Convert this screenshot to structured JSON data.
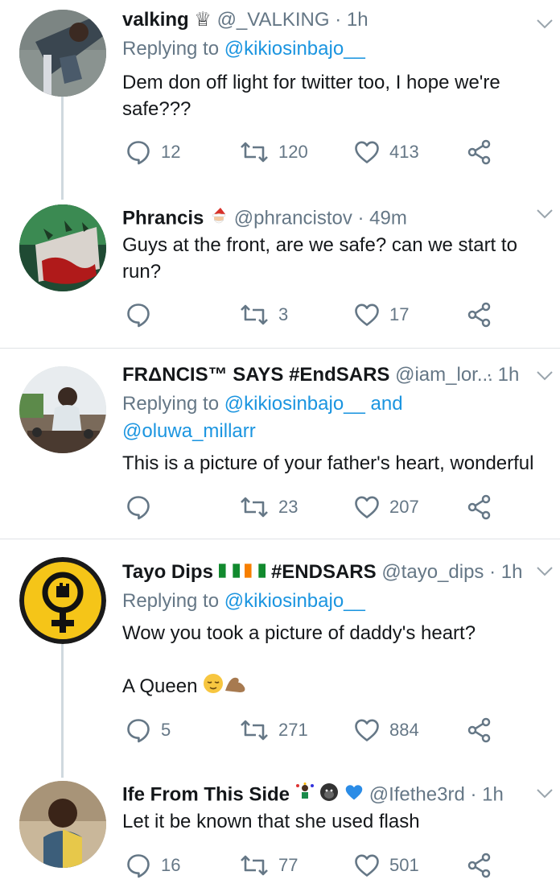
{
  "tweets": [
    {
      "name": "valking",
      "handle": "@_VALKING",
      "time": "· 1h",
      "reply_prefix": "Replying to ",
      "reply_to": "@kikiosinbajo__",
      "reply_to_2": "",
      "text": "Dem don off light for twitter too, I hope we're safe???",
      "replies": "12",
      "retweets": "120",
      "likes": "413"
    },
    {
      "name": "Phrancis",
      "handle": "@phrancistov",
      "time": "· 49m",
      "text": "Guys at the front, are we safe? can we start to run?",
      "replies": "",
      "retweets": "3",
      "likes": "17"
    },
    {
      "name": "FRΔNCIS™ SAYS #EndSARS",
      "handle": "@iam_lor...",
      "time": "· 1h",
      "reply_prefix": "Replying to ",
      "reply_to": "@kikiosinbajo__",
      "reply_and": " and",
      "reply_to_2": "@oluwa_millarr",
      "text": "This is a picture of your father's heart, wonderful",
      "replies": "",
      "retweets": "23",
      "likes": "207"
    },
    {
      "name": "Tayo Dips",
      "name_tag": "#ENDSARS",
      "handle": "@tayo_dips",
      "time": "· 1h",
      "reply_prefix": "Replying to ",
      "reply_to": "@kikiosinbajo__",
      "text": "Wow you took a picture of daddy's heart?",
      "text2": "A Queen",
      "replies": "5",
      "retweets": "271",
      "likes": "884"
    },
    {
      "name": "Ife From This Side",
      "handle": "@Ifethe3rd",
      "time": "· 1h",
      "text": "Let it be known that she used flash",
      "replies": "16",
      "retweets": "77",
      "likes": "501"
    }
  ],
  "colors": {
    "link": "#1b95e0",
    "muted": "#657786",
    "separator": "#dfe3e6"
  },
  "icons": [
    "reply-icon",
    "retweet-icon",
    "like-icon",
    "share-icon",
    "chevron-down-icon"
  ]
}
